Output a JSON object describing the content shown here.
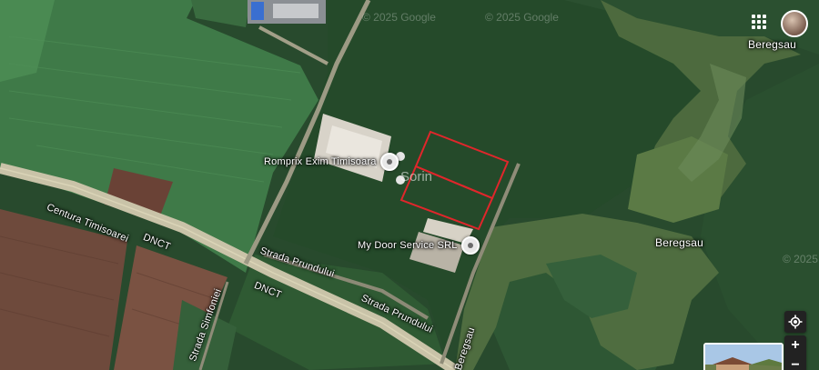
{
  "map": {
    "watermarks": [
      "© 2025 Google",
      "© 2025 Google",
      "© 2025"
    ],
    "center_label": "Sorin",
    "poi": [
      {
        "label": "Romprix Exim Timisoara",
        "icon": "place-pin-icon"
      },
      {
        "label": "My Door Service SRL",
        "icon": "place-pin-icon"
      }
    ],
    "streets": {
      "centura": "Centura Timisoarei",
      "dnct_1": "DNCT",
      "dnct_2": "DNCT",
      "prundului_1": "Strada Prundului",
      "prundului_2": "Strada Prundului",
      "simfoniei": "Strada Simfoniei",
      "beregsau_road": "Beregsau"
    },
    "river_labels": [
      "Beregsau",
      "Beregsau"
    ],
    "parcel_outline_color": "#e0262b"
  },
  "controls": {
    "apps_icon": "apps-grid-icon",
    "account_icon": "account-avatar",
    "my_location_icon": "my-location-icon",
    "zoom_in": "+",
    "zoom_out": "−"
  }
}
